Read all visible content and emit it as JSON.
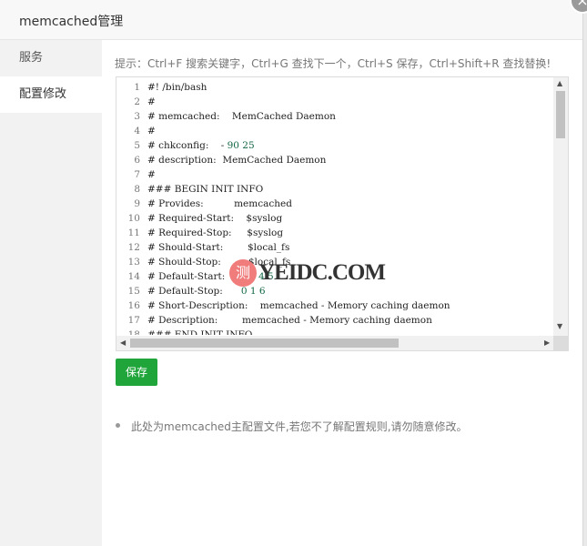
{
  "dialog": {
    "title": "memcached管理",
    "close_icon": "×"
  },
  "sidebar": {
    "items": [
      {
        "label": "服务",
        "active": false
      },
      {
        "label": "配置修改",
        "active": true
      }
    ]
  },
  "main": {
    "tip": "提示：Ctrl+F 搜索关键字，Ctrl+G 查找下一个，Ctrl+S 保存，Ctrl+Shift+R 查找替换!",
    "save_label": "保存",
    "note": "此处为memcached主配置文件,若您不了解配置规则,请勿随意修改。"
  },
  "editor": {
    "lines": [
      {
        "n": "1",
        "pre": "#! /bin/bash",
        "num": ""
      },
      {
        "n": "2",
        "pre": "#",
        "num": ""
      },
      {
        "n": "3",
        "pre": "# memcached:    MemCached Daemon",
        "num": ""
      },
      {
        "n": "4",
        "pre": "#",
        "num": ""
      },
      {
        "n": "5",
        "pre": "# chkconfig:    - ",
        "num": "90 25"
      },
      {
        "n": "6",
        "pre": "# description:  MemCached Daemon",
        "num": ""
      },
      {
        "n": "7",
        "pre": "#",
        "num": ""
      },
      {
        "n": "8",
        "pre": "### BEGIN INIT INFO",
        "num": ""
      },
      {
        "n": "9",
        "pre": "# Provides:          memcached",
        "num": ""
      },
      {
        "n": "10",
        "pre": "# Required-Start:    $syslog",
        "num": ""
      },
      {
        "n": "11",
        "pre": "# Required-Stop:     $syslog",
        "num": ""
      },
      {
        "n": "12",
        "pre": "# Should-Start:        $local_fs",
        "num": ""
      },
      {
        "n": "13",
        "pre": "# Should-Stop:         $local_fs",
        "num": ""
      },
      {
        "n": "14",
        "pre": "# Default-Start:     ",
        "num": "2 3 4 5"
      },
      {
        "n": "15",
        "pre": "# Default-Stop:      ",
        "num": "0 1 6"
      },
      {
        "n": "16",
        "pre": "# Short-Description:    memcached - Memory caching daemon",
        "num": ""
      },
      {
        "n": "17",
        "pre": "# Description:        memcached - Memory caching daemon",
        "num": ""
      },
      {
        "n": "18",
        "pre": "### END INIT INFO",
        "num": ""
      }
    ]
  },
  "watermark": {
    "glyph": "测",
    "text": "YEIDC.COM"
  }
}
